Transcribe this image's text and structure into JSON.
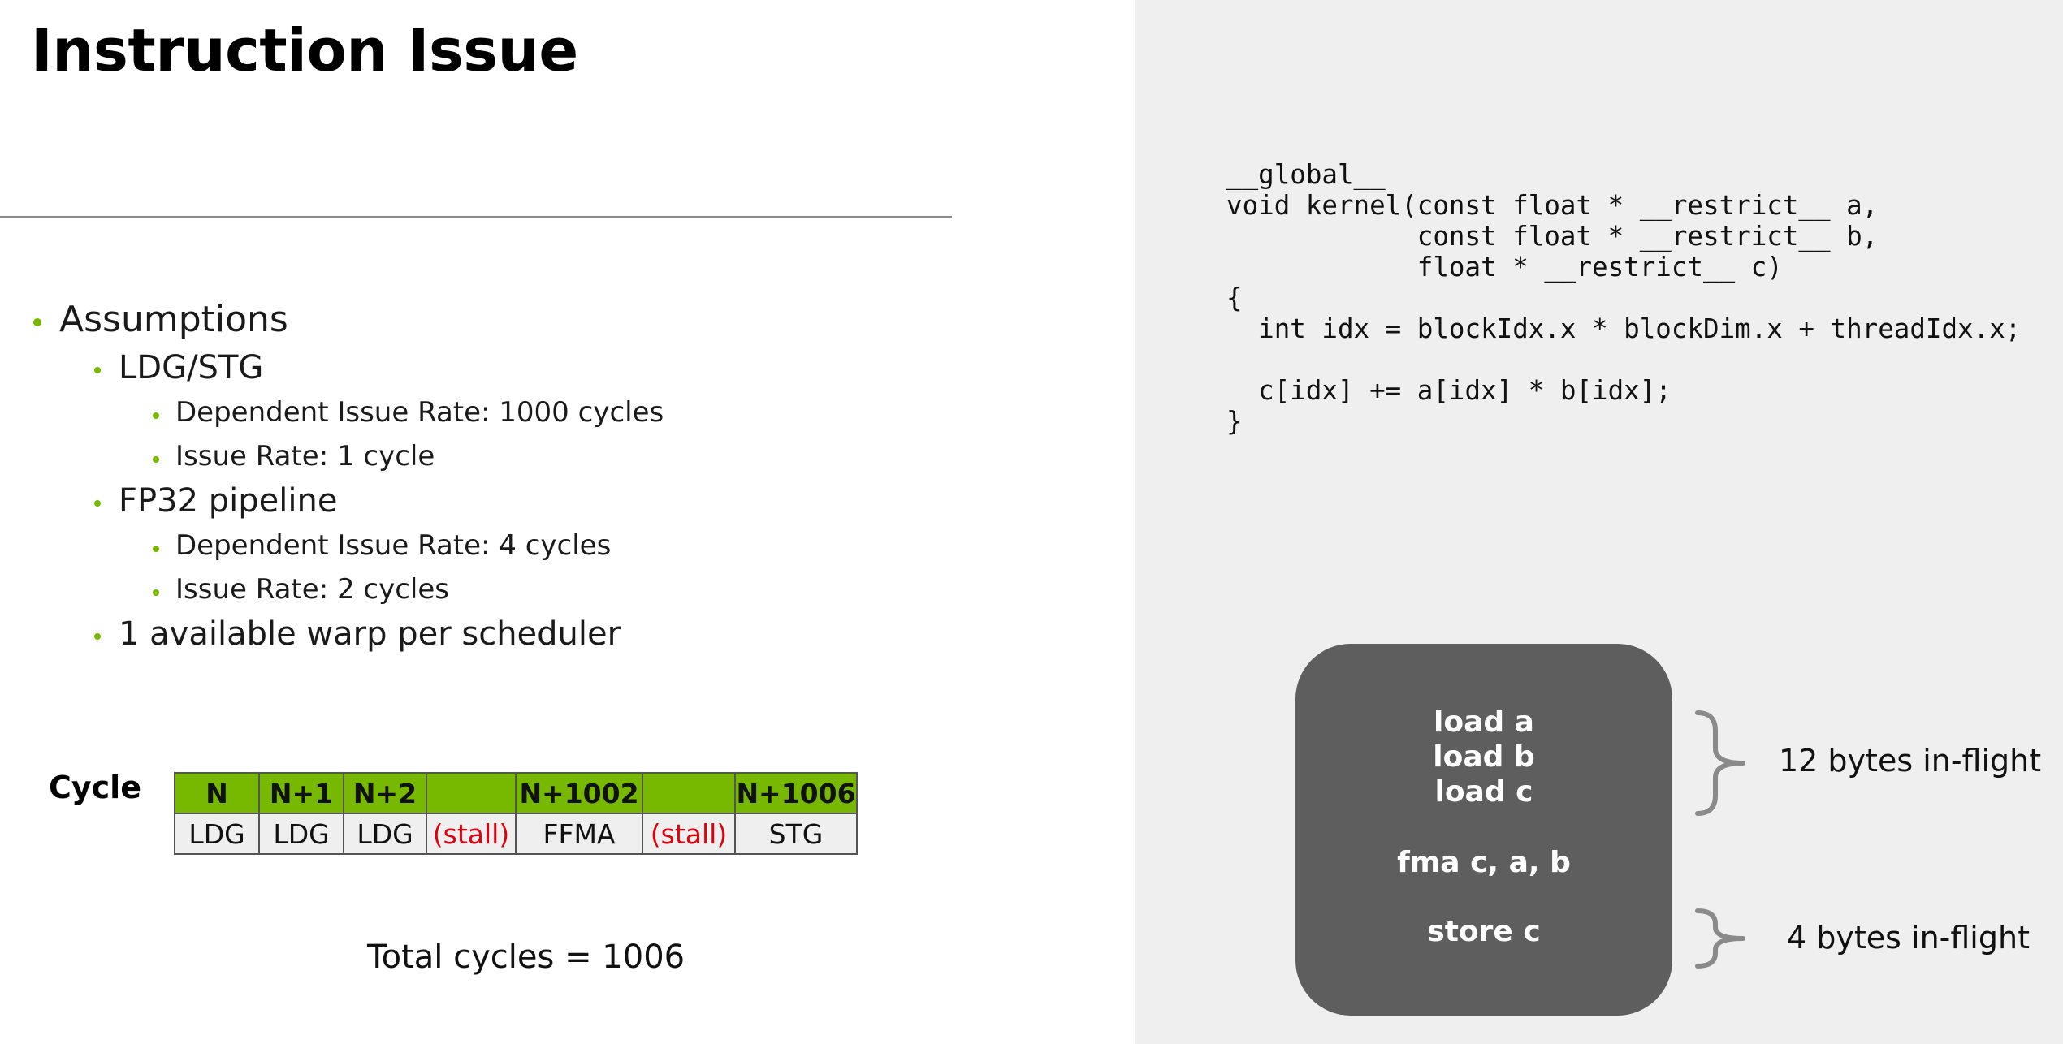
{
  "slide": {
    "title": "Instruction Issue"
  },
  "assumptions": {
    "heading": "Assumptions",
    "ldg_stg": {
      "label": "LDG/STG",
      "dependent_issue_rate": "Dependent Issue Rate: 1000 cycles",
      "issue_rate": "Issue Rate: 1 cycle"
    },
    "fp32": {
      "label": "FP32 pipeline",
      "dependent_issue_rate": "Dependent Issue Rate: 4 cycles",
      "issue_rate": "Issue Rate: 2 cycles"
    },
    "warp": "1 available warp per scheduler"
  },
  "timeline": {
    "label": "Cycle",
    "cycles": [
      "N",
      "N+1",
      "N+2",
      "",
      "N+1002",
      "",
      "N+1006"
    ],
    "ops": [
      "LDG",
      "LDG",
      "LDG",
      "(stall)",
      "FFMA",
      "(stall)",
      "STG"
    ]
  },
  "total": "Total cycles = 1006",
  "code": {
    "lines": [
      "__global__",
      "void kernel(const float * __restrict__ a,",
      "            const float * __restrict__ b,",
      "            float * __restrict__ c)",
      "{",
      "  int idx = blockIdx.x * blockDim.x + threadIdx.x;",
      "",
      "  c[idx] += a[idx] * b[idx];",
      "}"
    ]
  },
  "instructions": {
    "load_a": "load a",
    "load_b": "load b",
    "load_c": "load c",
    "fma": "fma c, a, b",
    "store": "store c"
  },
  "inflight": {
    "loads": "12 bytes in-flight",
    "store": "4 bytes in-flight"
  },
  "colors": {
    "accent": "#76b900",
    "stall": "#e0000e",
    "box": "#5e5e5e",
    "panel": "#efefef"
  }
}
